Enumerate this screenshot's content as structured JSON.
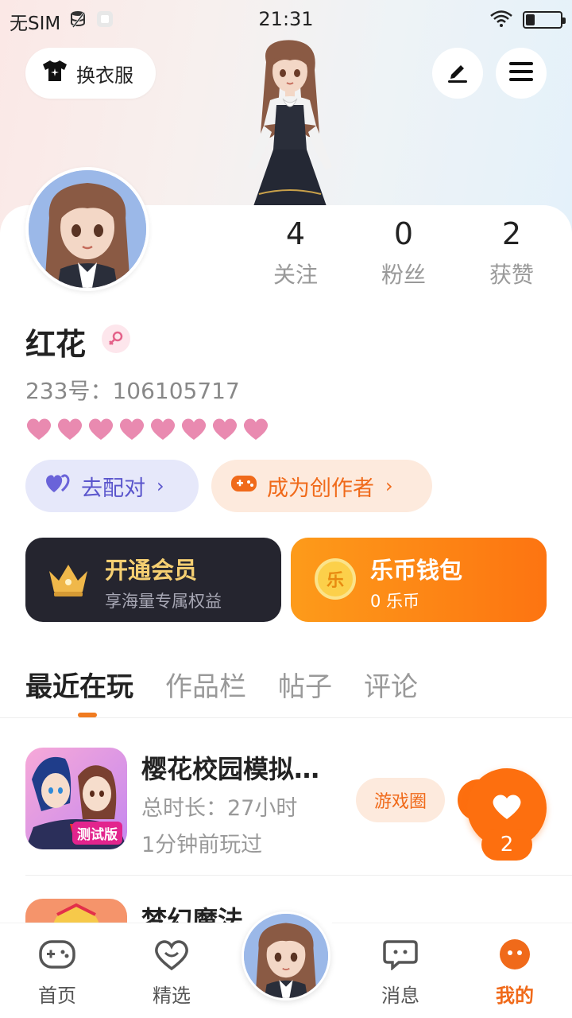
{
  "status_bar": {
    "carrier": "无SIM",
    "time": "21:31",
    "battery_level": 0.25
  },
  "header": {
    "outfit_label": "换衣服"
  },
  "profile": {
    "stats": [
      {
        "value": "4",
        "label": "关注"
      },
      {
        "value": "0",
        "label": "粉丝"
      },
      {
        "value": "2",
        "label": "获赞"
      }
    ],
    "name": "红花",
    "uid": "233号：106105717",
    "hearts_count": 8,
    "pair_label": "去配对",
    "creator_label": "成为创作者"
  },
  "cards": {
    "vip": {
      "title": "开通会员",
      "subtitle": "享海量专属权益"
    },
    "wallet": {
      "title": "乐币钱包",
      "subtitle": "0 乐币",
      "coin_glyph": "乐"
    }
  },
  "tabs": [
    "最近在玩",
    "作品栏",
    "帖子",
    "评论"
  ],
  "games": [
    {
      "name": "樱花校园模拟…",
      "duration": "总时长：27小时",
      "last_played": "1分钟前玩过",
      "badge": "测试版",
      "circle_label": "游戏圈"
    },
    {
      "name": "梦幻魔法"
    }
  ],
  "favorite": {
    "count": "2"
  },
  "bottom_nav": [
    {
      "label": "首页"
    },
    {
      "label": "精选"
    },
    {
      "label": "消息"
    },
    {
      "label": "我的"
    }
  ],
  "colors": {
    "accent": "#f06a1a",
    "orange": "#fd7411",
    "purple": "#5a55cc",
    "heart_pink": "#e98ab0"
  }
}
